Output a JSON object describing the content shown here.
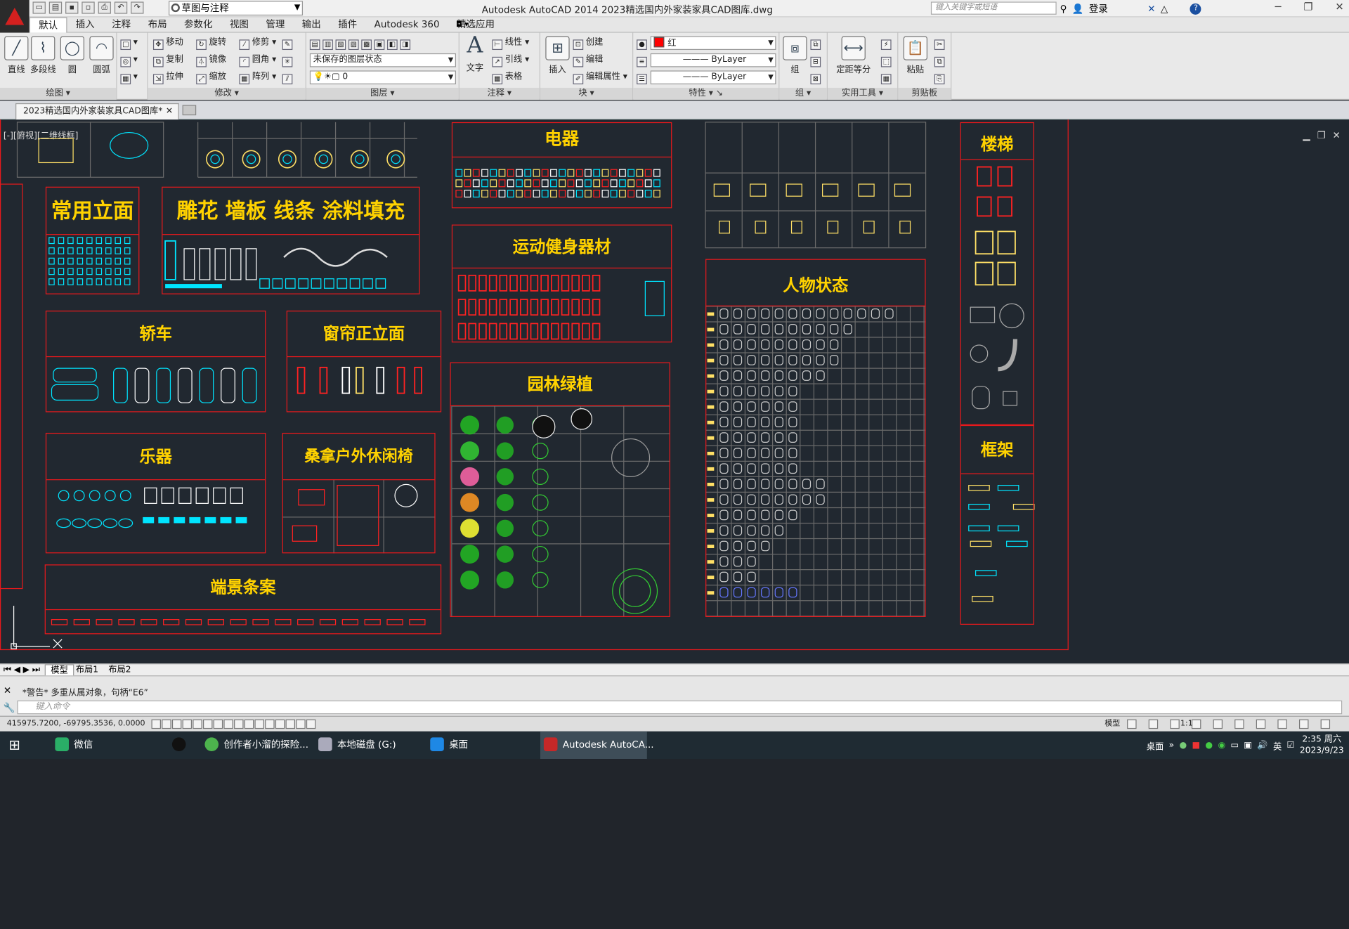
{
  "titlebar": {
    "workspace": "草图与注释",
    "title": "Autodesk AutoCAD 2014    2023精选国内外家装家具CAD图库.dwg",
    "search_placeholder": "键入关键字或短语",
    "login": "登录"
  },
  "menubar": {
    "tabs": [
      "默认",
      "插入",
      "注释",
      "布局",
      "参数化",
      "视图",
      "管理",
      "输出",
      "插件",
      "Autodesk 360",
      "精选应用"
    ]
  },
  "ribbon": {
    "draw": {
      "title": "绘图",
      "line": "直线",
      "polyline": "多段线",
      "circle": "圆",
      "arc": "圆弧"
    },
    "modify": {
      "title": "修改",
      "move": "移动",
      "rotate": "旋转",
      "trim": "修剪",
      "copy": "复制",
      "mirror": "镜像",
      "fillet": "圆角",
      "stretch": "拉伸",
      "scale": "缩放",
      "array": "阵列"
    },
    "layers": {
      "title": "图层",
      "state": "未保存的图层状态",
      "current": "0"
    },
    "annotation": {
      "title": "注释",
      "text": "文字",
      "linear": "线性",
      "leader": "引线",
      "table": "表格"
    },
    "block": {
      "title": "块",
      "insert": "插入",
      "create": "创建",
      "edit": "编辑",
      "edit_attr": "编辑属性"
    },
    "properties": {
      "title": "特性",
      "color": "红",
      "linetype": "ByLayer",
      "lineweight": "ByLayer"
    },
    "groups": {
      "title": "组",
      "group": "组"
    },
    "utilities": {
      "title": "实用工具",
      "measure": "定距等分"
    },
    "clipboard": {
      "title": "剪贴板",
      "paste": "粘贴"
    }
  },
  "doc_tab": {
    "label": "2023精选国内外家装家具CAD图库*"
  },
  "viewport": {
    "label": "[-][俯视][二维线框]"
  },
  "drawing": {
    "titles": {
      "elevation": "常用立面",
      "carving": "雕花  墙板  线条  涂料填充",
      "electric": "电器",
      "fitness": "运动健身器材",
      "car": "轿车",
      "curtain": "窗帘正立面",
      "garden": "园林绿植",
      "people": "人物状态",
      "instruments": "乐器",
      "sauna": "桑拿户外休闲椅",
      "altar": "端景条案",
      "stairs": "楼梯",
      "frame": "框架"
    }
  },
  "layout_tabs": [
    "模型",
    "布局1",
    "布局2"
  ],
  "command": {
    "history": "*警告* 多重从属对象，句柄“E6”",
    "placeholder": "键入命令"
  },
  "status": {
    "coords": "415975.7200, -69795.3536, 0.0000",
    "model": "模型",
    "scale": "1:1"
  },
  "taskbar": {
    "items": [
      "微信",
      "创作者小溜的探险...",
      "本地磁盘 (G:)",
      "桌面",
      "Autodesk AutoCA..."
    ],
    "tray_label": "桌面",
    "ime": "英",
    "time": "2:35 周六",
    "date": "2023/9/23"
  }
}
